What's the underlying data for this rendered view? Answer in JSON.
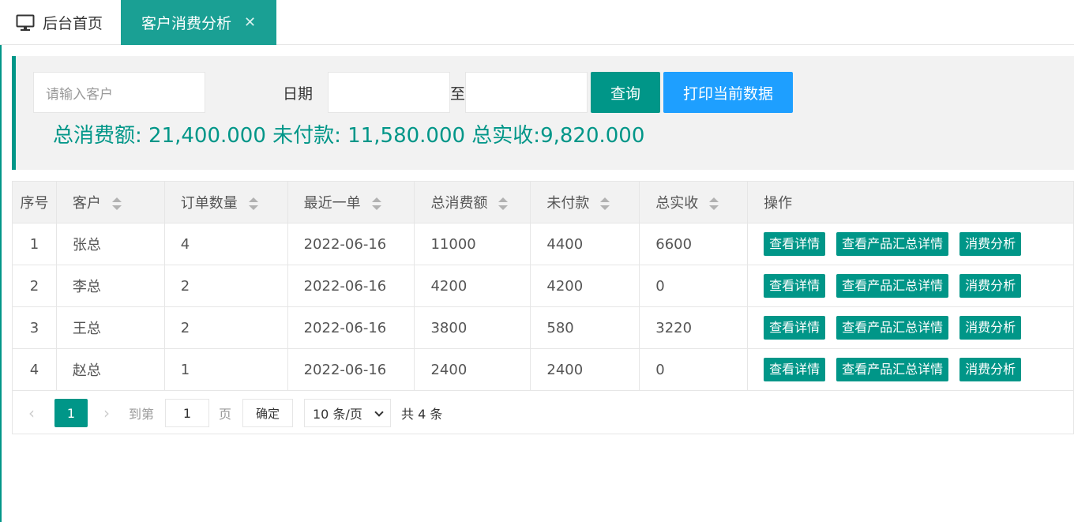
{
  "tabs": {
    "home": "后台首页",
    "active": "客户消费分析",
    "close": "✕"
  },
  "search": {
    "customer_placeholder": "请输入客户",
    "date_label": "日期",
    "to_label": "至",
    "start_date": "",
    "end_date": "",
    "query_button": "查询",
    "print_button": "打印当前数据"
  },
  "summary": "总消费额: 21,400.000 未付款: 11,580.000 总实收:9,820.000",
  "table": {
    "headers": [
      "序号",
      "客户",
      "订单数量",
      "最近一单",
      "总消费额",
      "未付款",
      "总实收",
      "操作"
    ],
    "rows": [
      {
        "seq": "1",
        "customer": "张总",
        "orders": "4",
        "last": "2022-06-16",
        "total": "11000",
        "unpaid": "4400",
        "received": "6600"
      },
      {
        "seq": "2",
        "customer": "李总",
        "orders": "2",
        "last": "2022-06-16",
        "total": "4200",
        "unpaid": "4200",
        "received": "0"
      },
      {
        "seq": "3",
        "customer": "王总",
        "orders": "2",
        "last": "2022-06-16",
        "total": "3800",
        "unpaid": "580",
        "received": "3220"
      },
      {
        "seq": "4",
        "customer": "赵总",
        "orders": "1",
        "last": "2022-06-16",
        "total": "2400",
        "unpaid": "2400",
        "received": "0"
      }
    ],
    "actions": {
      "detail": "查看详情",
      "product_summary": "查看产品汇总详情",
      "analysis": "消费分析"
    }
  },
  "pager": {
    "prev": "‹",
    "current": "1",
    "next": "›",
    "goto": "到第",
    "page_input": "1",
    "page_unit": "页",
    "ok": "确定",
    "page_size": "10 条/页",
    "total": "共 4 条"
  },
  "colors": {
    "accent": "#009688",
    "tab_active": "#1aa094",
    "print_button": "#1e9fff"
  }
}
